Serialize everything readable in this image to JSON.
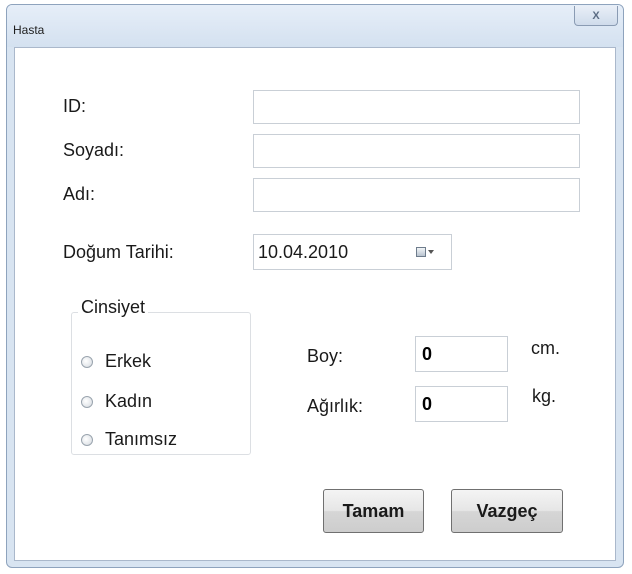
{
  "window": {
    "title": "Hasta",
    "close_glyph": "X"
  },
  "form": {
    "id_label": "ID:",
    "id_value": "",
    "soyadi_label": "Soyadı:",
    "soyadi_value": "",
    "adi_label": "Adı:",
    "adi_value": "",
    "dogum_tarihi_label": "Doğum Tarihi:",
    "dogum_tarihi_value": "10.04.2010",
    "calendar_icon": "calendar-dropdown-icon"
  },
  "cinsiyet": {
    "title": "Cinsiyet",
    "options": [
      {
        "label": "Erkek",
        "selected": false
      },
      {
        "label": "Kadın",
        "selected": false
      },
      {
        "label": "Tanımsız",
        "selected": false
      }
    ]
  },
  "measurements": {
    "boy_label": "Boy:",
    "boy_value": "0",
    "boy_unit": "cm.",
    "agirlik_label": "Ağırlık:",
    "agirlik_value": "0",
    "agirlik_unit": "kg."
  },
  "buttons": {
    "ok_label": "Tamam",
    "cancel_label": "Vazgeç"
  }
}
